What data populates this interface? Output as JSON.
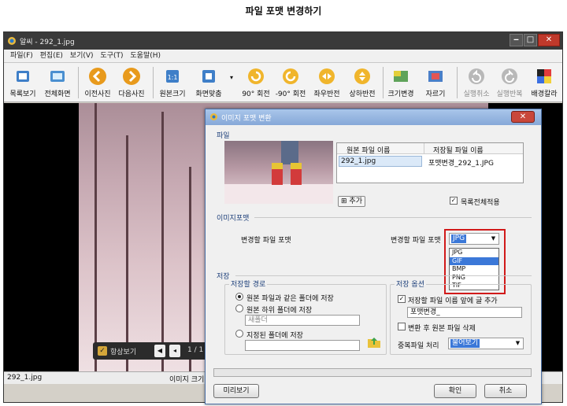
{
  "page": {
    "title": "파일 포맷 변경하기"
  },
  "window": {
    "title": "알씨 - 292_1.jpg"
  },
  "menu": {
    "items": [
      "파일(F)",
      "편집(E)",
      "보기(V)",
      "도구(T)",
      "도움말(H)"
    ]
  },
  "toolbar": {
    "buttons": [
      {
        "label": "목록보기",
        "icon": "list-view-icon"
      },
      {
        "label": "전체화면",
        "icon": "fullscreen-icon"
      },
      {
        "label": "이전사진",
        "icon": "prev-photo-icon"
      },
      {
        "label": "다음사진",
        "icon": "next-photo-icon"
      },
      {
        "label": "원본크기",
        "icon": "original-size-icon"
      },
      {
        "label": "화면맞춤",
        "icon": "fit-screen-icon"
      },
      {
        "label": "90° 회전",
        "icon": "rotate-cw-icon"
      },
      {
        "label": "-90° 회전",
        "icon": "rotate-ccw-icon"
      },
      {
        "label": "좌우반전",
        "icon": "flip-horizontal-icon"
      },
      {
        "label": "상하반전",
        "icon": "flip-vertical-icon"
      },
      {
        "label": "크기변경",
        "icon": "resize-icon"
      },
      {
        "label": "자르기",
        "icon": "crop-icon"
      },
      {
        "label": "실행취소",
        "icon": "undo-icon"
      },
      {
        "label": "실행반복",
        "icon": "redo-icon"
      },
      {
        "label": "배경칼라",
        "icon": "background-color-icon"
      }
    ]
  },
  "viewer": {
    "always_view_label": "항상보기",
    "page_indicator": "1 / 1"
  },
  "statusbar": {
    "filename": "292_1.jpg",
    "info": "이미지 크기"
  },
  "dialog": {
    "title": "이미지 포맷 변환",
    "file_section": {
      "label": "파일",
      "col_source": "원본 파일 이름",
      "col_target": "저장될 파일 이름",
      "source_file": "292_1.jpg",
      "target_file": "포맷변경_292_1.JPG",
      "add_button": "추가",
      "apply_all_label": "목록전체적용"
    },
    "format_section": {
      "label": "이미지포맷",
      "left_label": "변경할 파일 포맷",
      "right_label": "변경할 파일 포맷",
      "selected": "JPG",
      "options": [
        "JPG",
        "GIF",
        "BMP",
        "PNG",
        "TIF"
      ],
      "highlighted_option": "GIF"
    },
    "save_section": {
      "label": "저장",
      "path_group": "저장할 경로",
      "option_same_folder": "원본 파일과 같은 폴더에 저장",
      "option_subfolder": "원본 하위 폴더에 저장",
      "subfolder_placeholder": "새폴더",
      "option_specific": "지정된 폴더에 저장",
      "options_group": "저장 옵션",
      "opt_prefix_label": "저장할 파일 이름 앞에 글 추가",
      "prefix_value": "포맷변경_",
      "opt_delete_label": "변환 후 원본 파일 삭제",
      "duplicate_label": "중복파일 처리",
      "duplicate_value": "물어보기"
    },
    "buttons": {
      "preview": "미리보기",
      "ok": "확인",
      "cancel": "취소"
    }
  },
  "colors": {
    "accent": "#3b78d8",
    "highlight_box": "#d11a1a",
    "section_text": "#1d3f7a"
  }
}
